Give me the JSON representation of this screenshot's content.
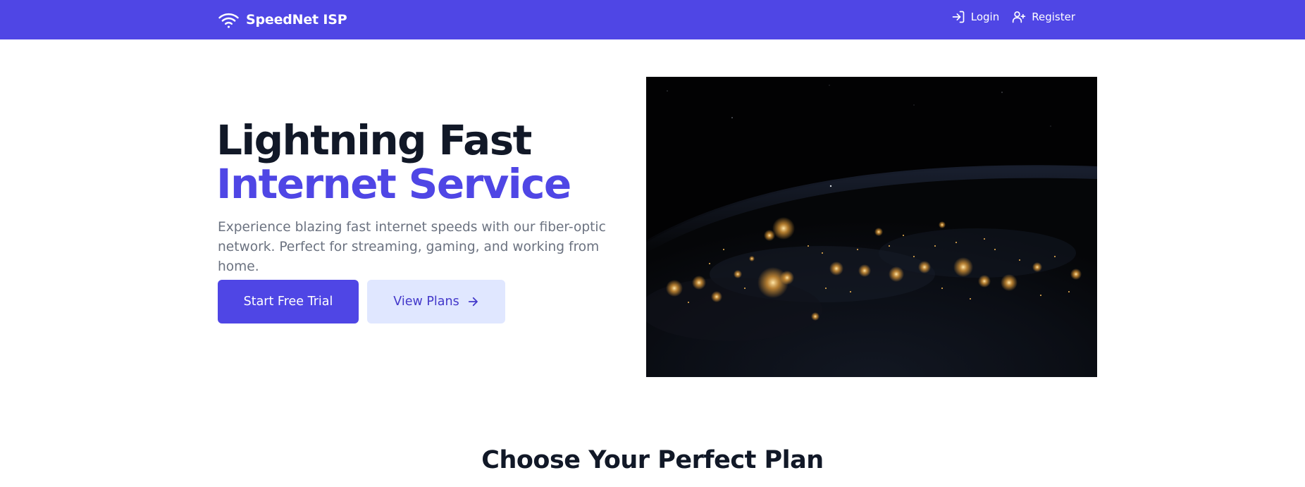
{
  "nav": {
    "brand": "SpeedNet ISP",
    "brand_icon": "wifi-icon",
    "links": [
      {
        "label": "Login",
        "icon": "login-icon"
      },
      {
        "label": "Register",
        "icon": "user-plus-icon"
      }
    ]
  },
  "hero": {
    "title_line1": "Lightning Fast",
    "title_line2": "Internet Service",
    "description": "Experience blazing fast internet speeds with our fiber-optic network. Perfect for streaming, gaming, and working from home.",
    "primary_button": "Start Free Trial",
    "secondary_button": "View Plans",
    "secondary_button_icon": "arrow-right-icon",
    "image": "earth-at-night-image"
  },
  "plans": {
    "heading": "Choose Your Perfect Plan"
  },
  "colors": {
    "brand": "#4f46e5",
    "heading": "#111827",
    "muted_text": "#6b7280",
    "secondary_button_bg": "#e0e7ff",
    "secondary_button_text": "#4338ca"
  }
}
